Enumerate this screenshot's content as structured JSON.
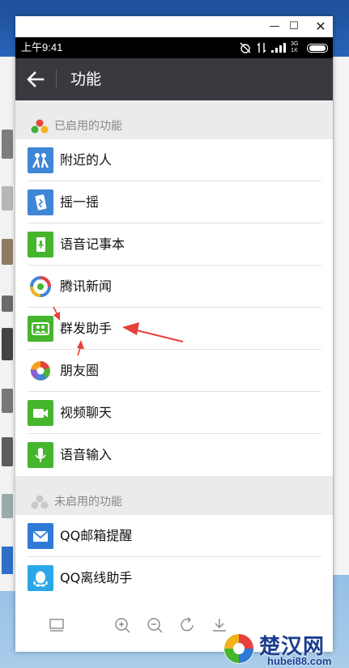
{
  "window": {
    "minimize": "—",
    "maximize": "☐",
    "close": "✕"
  },
  "status_bar": {
    "time": "上午9:41",
    "network": "3G 1X"
  },
  "app_bar": {
    "title": "功能"
  },
  "enabled_section": {
    "header": "已启用的功能"
  },
  "enabled_items": [
    {
      "label": "附近的人",
      "icon": "people-nearby-icon",
      "color": "#3f86d6"
    },
    {
      "label": "摇一摇",
      "icon": "shake-icon",
      "color": "#3f86d6"
    },
    {
      "label": "语音记事本",
      "icon": "voice-notepad-icon",
      "color": "#45b52e"
    },
    {
      "label": "腾讯新闻",
      "icon": "tencent-news-icon",
      "color": "#e54242"
    },
    {
      "label": "群发助手",
      "icon": "broadcast-icon",
      "color": "#45b52e"
    },
    {
      "label": "朋友圈",
      "icon": "moments-icon",
      "color": "#f2a21b"
    },
    {
      "label": "视频聊天",
      "icon": "video-chat-icon",
      "color": "#45b52e"
    },
    {
      "label": "语音输入",
      "icon": "voice-input-icon",
      "color": "#45b52e"
    }
  ],
  "disabled_section": {
    "header": "未启用的功能"
  },
  "disabled_items": [
    {
      "label": "QQ邮箱提醒",
      "icon": "qq-mail-icon",
      "color": "#2f7ad6"
    },
    {
      "label": "QQ离线助手",
      "icon": "qq-offline-icon",
      "color": "#2aa7e8"
    }
  ],
  "toolbar": {
    "buttons": [
      "screen-icon",
      "zoom-in-icon",
      "zoom-out-icon",
      "rotate-icon",
      "download-icon"
    ]
  },
  "watermark": {
    "main": "楚汉网",
    "sub": "hubei88.com"
  },
  "colors": {
    "app_bar": "#393a3f",
    "section_bg": "#ebebeb",
    "annotation": "#e8403a"
  }
}
